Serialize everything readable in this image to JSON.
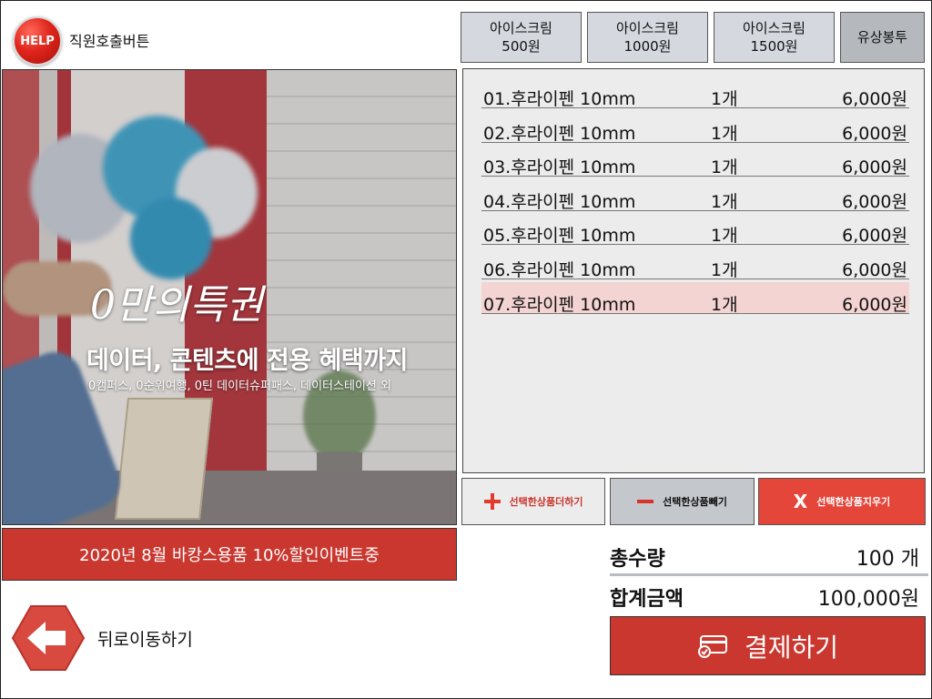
{
  "header": {
    "help_badge": "HELP",
    "help_label": "직원호출버튼"
  },
  "tabs": [
    {
      "line1": "아이스크림",
      "line2": "500원"
    },
    {
      "line1": "아이스크림",
      "line2": "1000원"
    },
    {
      "line1": "아이스크림",
      "line2": "1500원"
    },
    {
      "line1": "유상봉투",
      "line2": ""
    }
  ],
  "banner": {
    "logo": "0만의특권",
    "headline": "데이터, 콘텐츠에 전용 혜택까지",
    "subline": "0캠퍼스, 0순위여행, 0틴 데이터슈퍼패스, 데이터스테이션 외"
  },
  "promo": "2020년 8월 바캉스용품 10%할인이벤트중",
  "back_label": "뒤로이동하기",
  "items": [
    {
      "name": "01.후라이펜 10mm",
      "qty": "1개",
      "price": "6,000원",
      "selected": false
    },
    {
      "name": "02.후라이펜 10mm",
      "qty": "1개",
      "price": "6,000원",
      "selected": false
    },
    {
      "name": "03.후라이펜 10mm",
      "qty": "1개",
      "price": "6,000원",
      "selected": false
    },
    {
      "name": "04.후라이펜 10mm",
      "qty": "1개",
      "price": "6,000원",
      "selected": false
    },
    {
      "name": "05.후라이펜 10mm",
      "qty": "1개",
      "price": "6,000원",
      "selected": false
    },
    {
      "name": "06.후라이펜 10mm",
      "qty": "1개",
      "price": "6,000원",
      "selected": false
    },
    {
      "name": "07.후라이펜 10mm",
      "qty": "1개",
      "price": "6,000원",
      "selected": true
    }
  ],
  "actions": {
    "add_label": "선택한상품더하기",
    "remove_label": "선택한상품빼기",
    "clear_label": "선택한상품지우기",
    "clear_symbol": "X"
  },
  "totals": {
    "qty_label": "총수량",
    "qty_value": "100 개",
    "amount_label": "합계금액",
    "amount_value": "100,000원"
  },
  "pay_label": "결제하기",
  "colors": {
    "accent_red": "#c9372f",
    "selected_row": "#f3d4d2",
    "tab_bg": "#d5d8de"
  }
}
